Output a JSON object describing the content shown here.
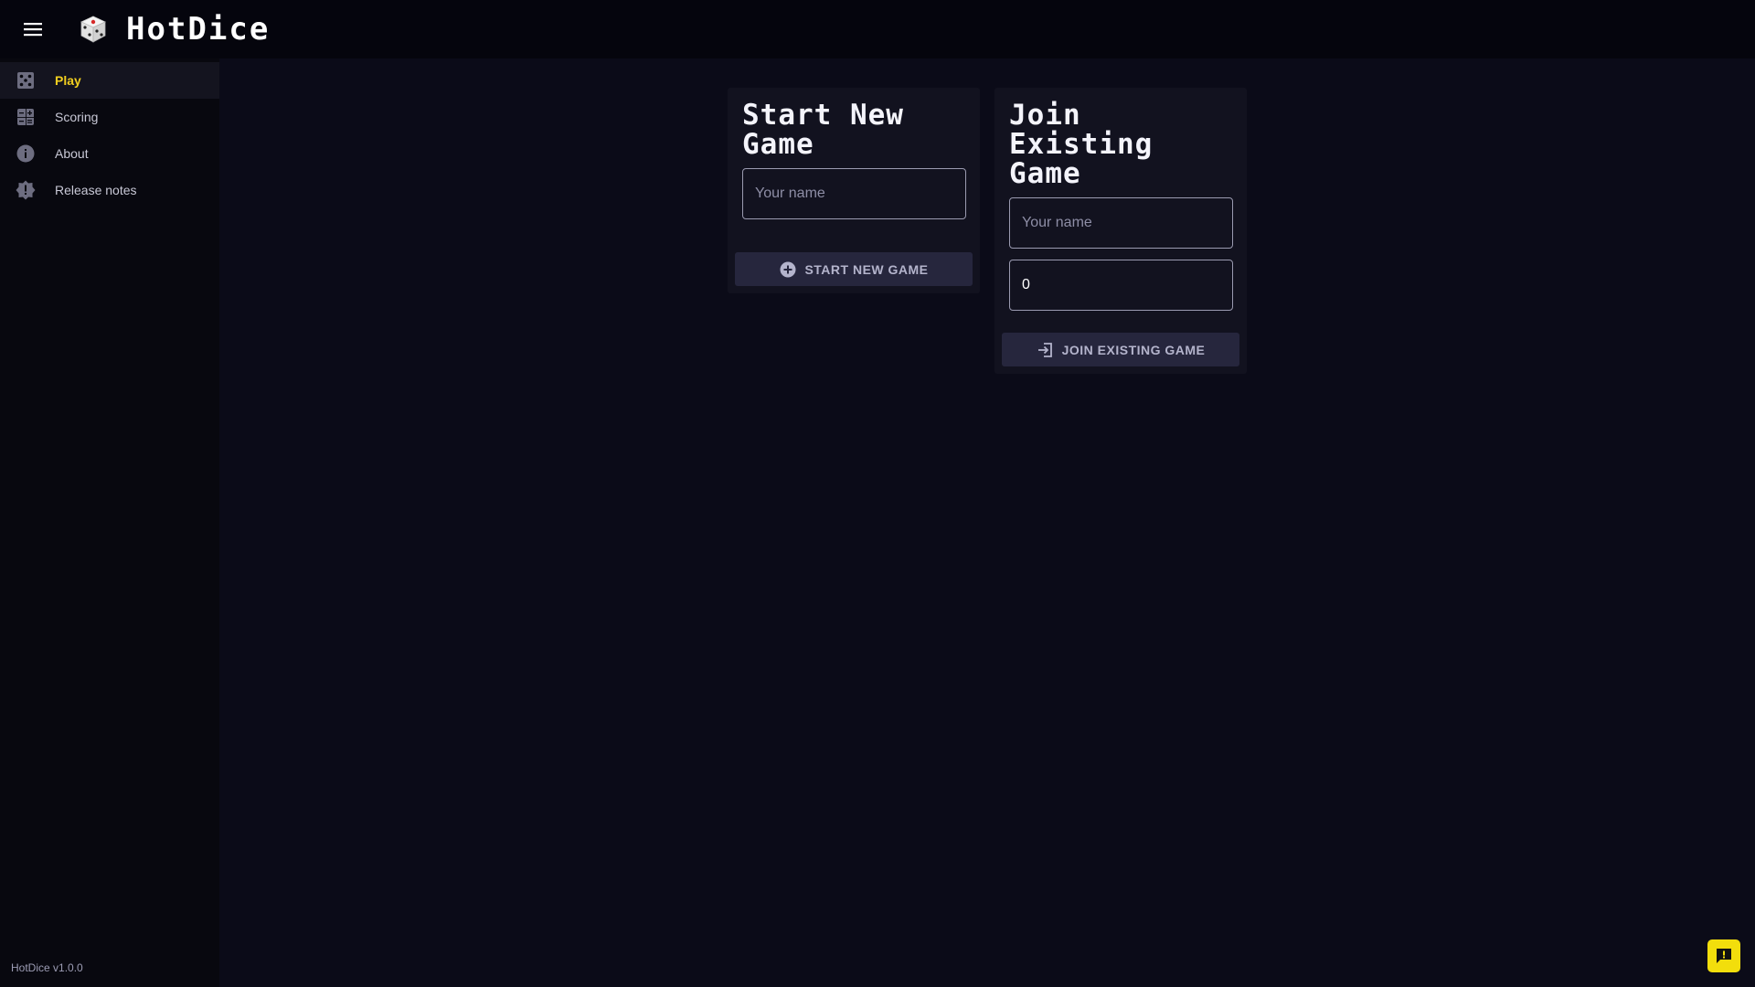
{
  "app": {
    "title": "HotDice",
    "version": "HotDice v1.0.0",
    "accent_color": "#f2cf1f",
    "logo_icon": "dice-icon"
  },
  "sidebar": {
    "items": [
      {
        "label": "Play",
        "icon": "dice-five-icon",
        "active": true
      },
      {
        "label": "Scoring",
        "icon": "calculator-icon",
        "active": false
      },
      {
        "label": "About",
        "icon": "info-icon",
        "active": false
      },
      {
        "label": "Release notes",
        "icon": "new-releases-icon",
        "active": false
      }
    ]
  },
  "start_card": {
    "title": "Start New Game",
    "name_placeholder": "Your name",
    "button_label": "START NEW GAME",
    "button_icon": "add-circle-icon"
  },
  "join_card": {
    "title": "Join Existing Game",
    "name_placeholder": "Your name",
    "game_id_value": "0",
    "button_label": "JOIN EXISTING GAME",
    "button_icon": "login-icon"
  },
  "feedback": {
    "icon": "feedback-icon",
    "color": "#f2de0c"
  }
}
